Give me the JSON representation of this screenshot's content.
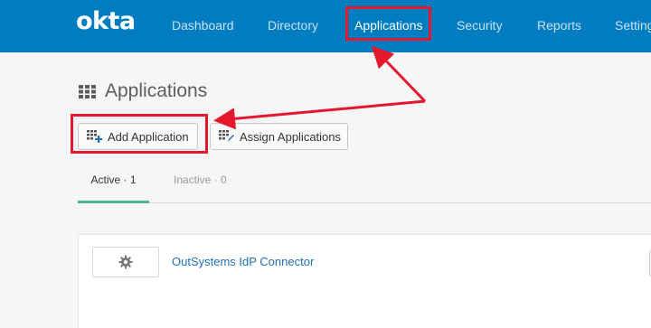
{
  "brand": {
    "logo_text": "okta"
  },
  "nav": {
    "items": [
      {
        "label": "Dashboard"
      },
      {
        "label": "Directory"
      },
      {
        "label": "Applications",
        "active": true
      },
      {
        "label": "Security"
      },
      {
        "label": "Reports"
      },
      {
        "label": "Settings"
      }
    ]
  },
  "page": {
    "title": "Applications"
  },
  "toolbar": {
    "add_label": "Add Application",
    "assign_label": "Assign Applications"
  },
  "tabs": [
    {
      "label": "Active · 1",
      "active": true
    },
    {
      "label": "Inactive · 0",
      "active": false
    }
  ],
  "apps": [
    {
      "name": "OutSystems IdP Connector",
      "icon": "gear-icon"
    }
  ],
  "colors": {
    "nav_bg": "#007dc1",
    "tab_accent": "#4bb68c",
    "annotation": "#e4172c",
    "link": "#1f6fb2"
  }
}
